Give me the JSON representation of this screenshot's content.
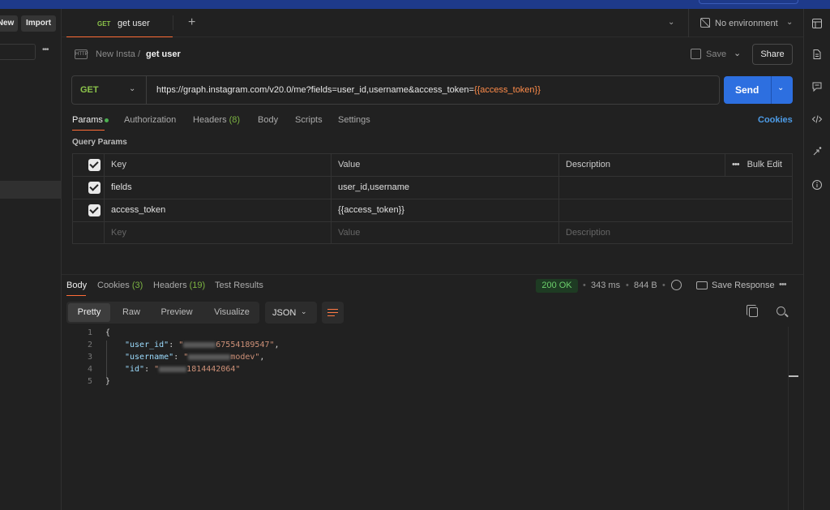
{
  "sidebar": {
    "new_label": "New",
    "import_label": "Import",
    "more": "•••"
  },
  "tab": {
    "method": "GET",
    "title": "get user",
    "add": "+",
    "chevron": "⌄"
  },
  "environment": {
    "label": "No environment",
    "chevron": "⌄"
  },
  "breadcrumb": {
    "icon_text": "HTTP",
    "parent": "New Insta",
    "separator": "/",
    "current": "get user"
  },
  "toolbar": {
    "save_label": "Save",
    "save_chevron": "⌄",
    "share_label": "Share"
  },
  "request": {
    "method": "GET",
    "url_prefix": "https://graph.instagram.com/v20.0/me?fields=user_id,username&access_token=",
    "url_variable": "{{access_token}}",
    "send_label": "Send",
    "send_chevron": "⌄"
  },
  "request_tabs": {
    "params": "Params",
    "authorization": "Authorization",
    "headers": "Headers",
    "headers_count": "(8)",
    "body": "Body",
    "scripts": "Scripts",
    "settings": "Settings",
    "cookies": "Cookies"
  },
  "query_params": {
    "title": "Query Params",
    "headers": {
      "key": "Key",
      "value": "Value",
      "description": "Description",
      "bulk_edit": "Bulk Edit",
      "more": "•••"
    },
    "rows": [
      {
        "key": "fields",
        "value": "user_id,username",
        "checked": true
      },
      {
        "key": "access_token",
        "value": "{{access_token}}",
        "checked": true
      }
    ],
    "placeholder": {
      "key": "Key",
      "value": "Value",
      "description": "Description"
    }
  },
  "response_tabs": {
    "body": "Body",
    "cookies": "Cookies",
    "cookies_count": "(3)",
    "headers": "Headers",
    "headers_count": "(19)",
    "test_results": "Test Results"
  },
  "response_meta": {
    "status": "200 OK",
    "time": "343 ms",
    "size": "844 B",
    "save_response": "Save Response",
    "more": "•••",
    "sep": "•"
  },
  "format": {
    "pretty": "Pretty",
    "raw": "Raw",
    "preview": "Preview",
    "visualize": "Visualize",
    "language": "JSON",
    "chevron": "⌄"
  },
  "response_body": {
    "line_numbers": [
      "1",
      "2",
      "3",
      "4",
      "5"
    ],
    "open_brace": "{",
    "close_brace": "}",
    "user_id_key": "\"user_id\"",
    "user_id_tail": "67554189547\"",
    "username_key": "\"username\"",
    "username_tail": "modev\"",
    "id_key": "\"id\"",
    "id_tail": "1814442064\"",
    "colon": ": ",
    "comma": ",",
    "quote": "\""
  }
}
